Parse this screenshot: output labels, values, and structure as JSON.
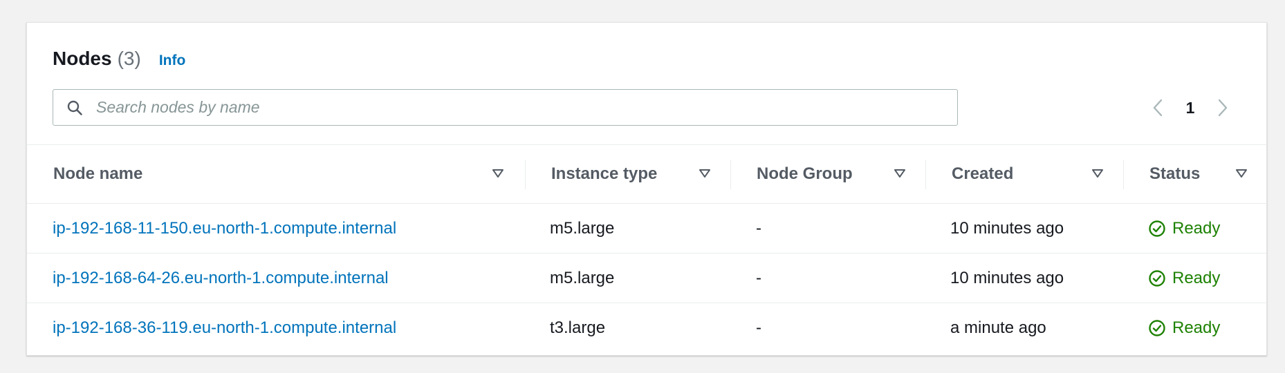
{
  "nodes_panel": {
    "title": "Nodes",
    "count": "(3)",
    "info_label": "Info"
  },
  "search": {
    "placeholder": "Search nodes by name",
    "value": ""
  },
  "pagination": {
    "current_page": "1"
  },
  "table": {
    "columns": [
      {
        "label": "Node name"
      },
      {
        "label": "Instance type"
      },
      {
        "label": "Node Group"
      },
      {
        "label": "Created"
      },
      {
        "label": "Status"
      }
    ],
    "rows": [
      {
        "node_name": "ip-192-168-11-150.eu-north-1.compute.internal",
        "instance_type": "m5.large",
        "node_group": "-",
        "created": "10 minutes ago",
        "status": "Ready"
      },
      {
        "node_name": "ip-192-168-64-26.eu-north-1.compute.internal",
        "instance_type": "m5.large",
        "node_group": "-",
        "created": "10 minutes ago",
        "status": "Ready"
      },
      {
        "node_name": "ip-192-168-36-119.eu-north-1.compute.internal",
        "instance_type": "t3.large",
        "node_group": "-",
        "created": "a minute ago",
        "status": "Ready"
      }
    ]
  },
  "icons": {
    "search": "search-icon",
    "sort": "caret-down-outline-icon",
    "prev": "chevron-left-icon",
    "next": "chevron-right-icon",
    "status_ok": "check-circle-icon"
  },
  "colors": {
    "link": "#0073bb",
    "success": "#1d8102",
    "header_text": "#545b64",
    "placeholder": "#879596",
    "background": "#f2f2f2"
  }
}
